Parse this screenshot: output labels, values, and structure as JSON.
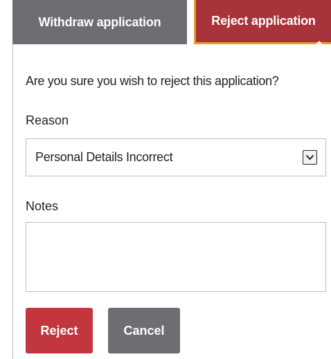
{
  "tabs": {
    "withdraw_label": "Withdraw application",
    "reject_label": "Reject application"
  },
  "dialog": {
    "prompt": "Are you sure you wish to reject this application?",
    "reason_label": "Reason",
    "reason_value": "Personal Details Incorrect",
    "notes_label": "Notes",
    "notes_value": ""
  },
  "buttons": {
    "reject_label": "Reject",
    "cancel_label": "Cancel"
  },
  "colors": {
    "tab_inactive": "#6d6e71",
    "tab_active": "#a8333a",
    "tab_accent": "#e3a12a",
    "reject_button": "#c2373e",
    "cancel_button": "#6d6e71"
  },
  "icons": {
    "select_arrow": "chevron-down-icon"
  }
}
